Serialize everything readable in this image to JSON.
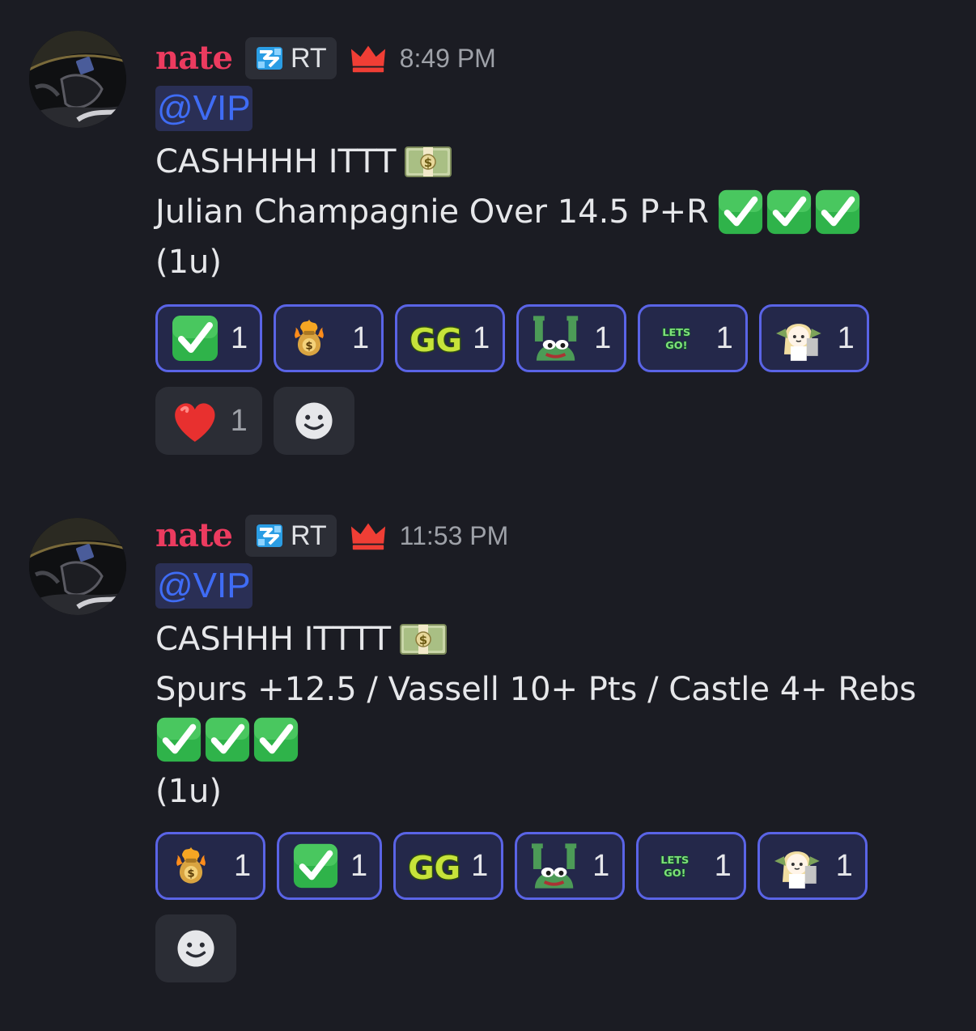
{
  "messages": [
    {
      "username": "nate",
      "role_tag": "RT",
      "timestamp": "8:49 PM",
      "mention": "@VIP",
      "line1": "CASHHHH ITTT",
      "line2": "Julian Champagnie Over 14.5 P+R",
      "line3": "(1u)",
      "reactions_row1": [
        {
          "icon": "check-mark-emoji",
          "count": "1"
        },
        {
          "icon": "money-bag-fire-emoji",
          "count": "1"
        },
        {
          "icon": "gg-emoji",
          "count": "1"
        },
        {
          "icon": "pepe-emoji",
          "count": "1"
        },
        {
          "icon": "lets-go-emoji",
          "count": "1"
        },
        {
          "icon": "anime-girl-emoji",
          "count": "1"
        }
      ],
      "reactions_row2": [
        {
          "icon": "red-heart-emoji",
          "count": "1"
        }
      ]
    },
    {
      "username": "nate",
      "role_tag": "RT",
      "timestamp": "11:53 PM",
      "mention": "@VIP",
      "line1": "CASHHH ITTTT",
      "line2": "Spurs +12.5 / Vassell 10+ Pts / Castle 4+ Rebs",
      "line3": "(1u)",
      "reactions_row1": [
        {
          "icon": "money-bag-fire-emoji",
          "count": "1"
        },
        {
          "icon": "check-mark-emoji",
          "count": "1"
        },
        {
          "icon": "gg-emoji",
          "count": "1"
        },
        {
          "icon": "pepe-emoji",
          "count": "1"
        },
        {
          "icon": "lets-go-emoji",
          "count": "1"
        },
        {
          "icon": "anime-girl-emoji",
          "count": "1"
        }
      ]
    }
  ],
  "colors": {
    "background": "#1b1c23",
    "username": "#ec3b5f",
    "mention": "#3f6cf5",
    "reaction_border": "#5a64e6"
  }
}
